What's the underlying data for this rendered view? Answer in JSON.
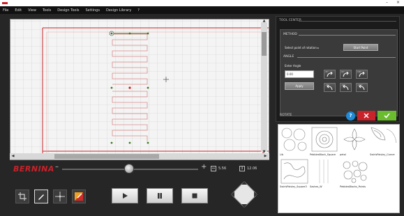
{
  "menu": [
    "File",
    "Edit",
    "View",
    "Tools",
    "Design Tools",
    "Settings",
    "Design Library",
    "?"
  ],
  "window_controls": [
    "–",
    "×"
  ],
  "brand": "BERNINA",
  "zoom": {
    "minus": "–",
    "plus": "+"
  },
  "dimensions": {
    "width": "5.56",
    "height": "12.06"
  },
  "tool_center": {
    "title": "TOOL CENTER",
    "method_label": "METHOD",
    "select_point_label": "Select point of rotation ▸",
    "start_point_button": "Start Point",
    "angle_label": "ANGLE",
    "enter_angle_label": "Enter Angle",
    "angle_value": "0.00",
    "apply_button": "Apply",
    "rotate_label": "ROTATE",
    "help_label": "?",
    "rotation_presets": [
      "45°",
      "90°",
      "180°",
      "-45°",
      "-90°",
      "-180°"
    ]
  },
  "library": {
    "items": [
      {
        "name": "Lib"
      },
      {
        "name": "PebblesBlock_Square"
      },
      {
        "name": "petal"
      },
      {
        "name": "SwirlsPaisley_Corner"
      },
      {
        "name": "SwirlsPaisley_Square3"
      },
      {
        "name": "Sashes_W"
      },
      {
        "name": "PebblesBlocks_Points"
      }
    ]
  },
  "colors": {
    "accent_red": "#c8222a",
    "ok_green": "#6abb2e",
    "help_blue": "#1f8ad6",
    "stitch_red": "#d88a8a",
    "node_green": "#3a7a1a"
  }
}
